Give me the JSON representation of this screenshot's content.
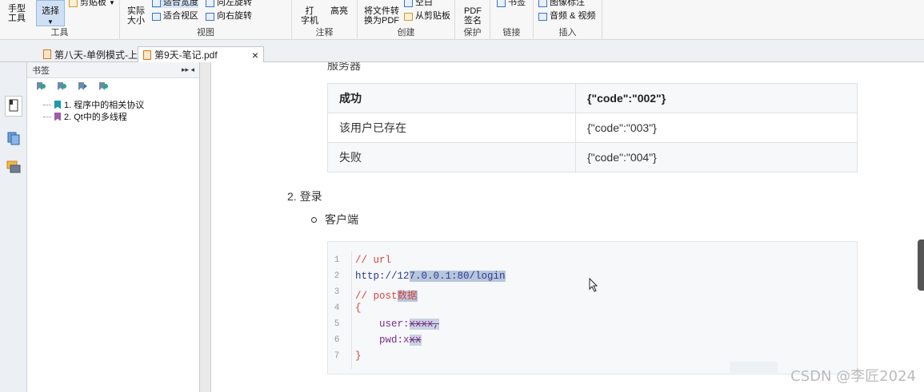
{
  "ribbon": {
    "tools": {
      "hand": "手型\n工具",
      "select": "选择",
      "clipboard": "剪贴板",
      "group": "工具"
    },
    "view": {
      "actual_size": "实际\n大小",
      "fit_width": "适合宽度",
      "fit_view": "适合视区",
      "rotate_left": "向左旋转",
      "rotate_right": "向右旋转",
      "group": "视图"
    },
    "comment": {
      "typewriter": "打\n字机",
      "highlight": "高亮",
      "group": "注释"
    },
    "create": {
      "convert": "将文件转\n换为PDF",
      "blank": "空白",
      "from_clipboard": "从剪贴板",
      "group": "创建"
    },
    "protect": {
      "sign": "PDF\n签名",
      "group": "保护"
    },
    "link": {
      "bookmark": "书签",
      "group": "链接"
    },
    "insert": {
      "image": "图像标注",
      "audio_video": "音频 & 视频",
      "group": "插入"
    }
  },
  "tabs": [
    {
      "label": "第八天-单例模式-上...",
      "active": false
    },
    {
      "label": "第9天-笔记.pdf",
      "active": true,
      "close": "×"
    }
  ],
  "bookmarks_panel": {
    "title": "书签",
    "items": [
      {
        "label": "1. 程序中的相关协议",
        "color": "#1b9aa8"
      },
      {
        "label": "2. Qt中的多线程",
        "color": "#a05aa8"
      }
    ]
  },
  "document": {
    "cut_heading": "服务器",
    "table": [
      [
        "成功",
        "{\"code\":\"002\"}"
      ],
      [
        "该用户已存在",
        "{\"code\":\"003\"}"
      ],
      [
        "失败",
        "{\"code\":\"004\"}"
      ]
    ],
    "section": "2. 登录",
    "subsection": "客户端",
    "code": {
      "line_numbers": [
        "1",
        "2",
        "3",
        "4",
        "5",
        "6",
        "7"
      ],
      "l1": "// url",
      "l2a": "http://12",
      "l2b": "7.0.0.1:80/login",
      "l3a": "// post",
      "l3b": "数据",
      "l4": "{",
      "l5a": "    user:",
      "l5b": "xxxx,",
      "l6a": "    pwd:x",
      "l6b": "xx",
      "l7": "}"
    }
  },
  "watermark": "CSDN @李匠2024"
}
